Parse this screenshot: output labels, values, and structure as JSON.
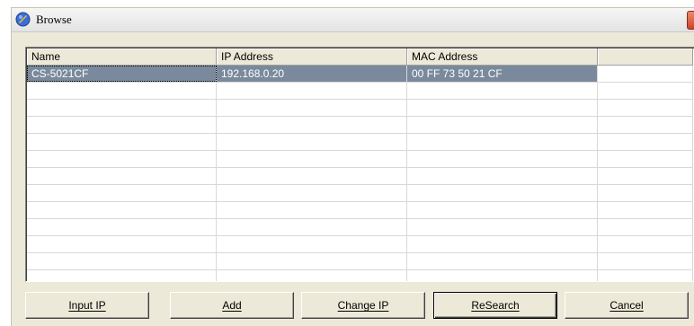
{
  "window": {
    "title": "Browse"
  },
  "list": {
    "columns": [
      "Name",
      "IP Address",
      "MAC Address",
      ""
    ],
    "rows": [
      {
        "name": "CS-5021CF",
        "ip": "192.168.0.20",
        "mac": "00 FF 73 50 21 CF",
        "selected": true
      }
    ],
    "empty_rows": 12
  },
  "buttons": {
    "input_ip": "Input IP",
    "add": "Add",
    "change_ip": "Change IP",
    "research": "ReSearch",
    "cancel": "Cancel"
  },
  "colors": {
    "selection": "#7a8a9c",
    "dialog_bg": "#ece9d8"
  }
}
